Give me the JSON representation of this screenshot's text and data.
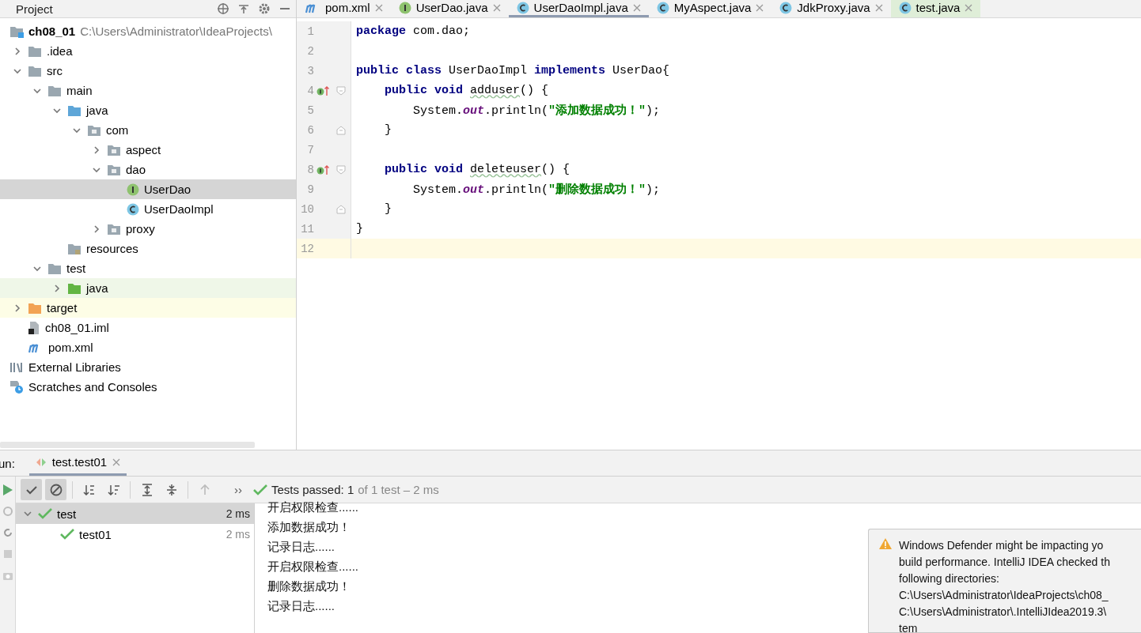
{
  "project_panel": {
    "title": "Project",
    "tree": [
      {
        "label": "ch08_01",
        "kind": "module",
        "path": "C:\\Users\\Administrator\\IdeaProjects\\",
        "expanded": true,
        "selected": false,
        "children": [
          {
            "label": ".idea",
            "kind": "folder",
            "expanded": false,
            "selected": false
          },
          {
            "label": "src",
            "kind": "folder",
            "expanded": true,
            "selected": false,
            "children": [
              {
                "label": "main",
                "kind": "folder",
                "expanded": true,
                "selected": false,
                "children": [
                  {
                    "label": "java",
                    "kind": "source",
                    "expanded": true,
                    "selected": false,
                    "children": [
                      {
                        "label": "com",
                        "kind": "package",
                        "expanded": true,
                        "selected": false,
                        "children": [
                          {
                            "label": "aspect",
                            "kind": "package",
                            "expanded": false,
                            "selected": false
                          },
                          {
                            "label": "dao",
                            "kind": "package",
                            "expanded": true,
                            "selected": false,
                            "children": [
                              {
                                "label": "UserDao",
                                "kind": "interface",
                                "selected": true
                              },
                              {
                                "label": "UserDaoImpl",
                                "kind": "class",
                                "selected": false
                              }
                            ]
                          },
                          {
                            "label": "proxy",
                            "kind": "package",
                            "expanded": false,
                            "selected": false
                          }
                        ]
                      }
                    ]
                  },
                  {
                    "label": "resources",
                    "kind": "resources",
                    "selected": false
                  }
                ]
              },
              {
                "label": "test",
                "kind": "folder",
                "expanded": true,
                "selected": false,
                "children": [
                  {
                    "label": "java",
                    "kind": "test-source",
                    "expanded": false,
                    "selected": false
                  }
                ]
              }
            ]
          },
          {
            "label": "target",
            "kind": "excluded",
            "expanded": false,
            "selected": false
          },
          {
            "label": "ch08_01.iml",
            "kind": "iml",
            "selected": false
          },
          {
            "label": "pom.xml",
            "kind": "maven",
            "selected": false
          }
        ]
      },
      {
        "label": "External Libraries",
        "kind": "libraries",
        "selected": false
      },
      {
        "label": "Scratches and Consoles",
        "kind": "scratches",
        "selected": false
      }
    ]
  },
  "editor": {
    "tabs": [
      {
        "label": "pom.xml",
        "kind": "maven",
        "selected": false,
        "test": false
      },
      {
        "label": "UserDao.java",
        "kind": "interface",
        "selected": false,
        "test": false
      },
      {
        "label": "UserDaoImpl.java",
        "kind": "class",
        "selected": true,
        "test": false
      },
      {
        "label": "MyAspect.java",
        "kind": "class",
        "selected": false,
        "test": false
      },
      {
        "label": "JdkProxy.java",
        "kind": "class",
        "selected": false,
        "test": false
      },
      {
        "label": "test.java",
        "kind": "class",
        "selected": false,
        "test": true
      }
    ],
    "lines": [
      {
        "number": "1",
        "kind": "top",
        "current": false,
        "tokens": [
          {
            "kind": "keyword",
            "text": "package"
          },
          {
            "kind": "plain",
            "text": " com.dao;"
          }
        ]
      },
      {
        "number": "2",
        "current": false
      },
      {
        "number": "3",
        "kind": "top",
        "current": false,
        "tokens": [
          {
            "kind": "keyword",
            "text": "public class"
          },
          {
            "kind": "plain",
            "text": " UserDaoImpl "
          },
          {
            "kind": "keyword",
            "text": "implements"
          },
          {
            "kind": "plain",
            "text": " UserDao{"
          }
        ]
      },
      {
        "number": "4",
        "kind": "member",
        "current": false,
        "implements": true,
        "fold_start": true,
        "tokens": [
          {
            "kind": "keyword",
            "text": "public void "
          },
          {
            "kind": "unused",
            "text": "adduser"
          },
          {
            "kind": "plain",
            "text": "() {"
          }
        ]
      },
      {
        "number": "5",
        "kind": "statement",
        "current": false,
        "tokens": [
          {
            "kind": "plain",
            "text": "System."
          },
          {
            "kind": "static",
            "text": "out"
          },
          {
            "kind": "plain",
            "text": ".println("
          },
          {
            "kind": "string",
            "text": "\"添加数据成功！\""
          },
          {
            "kind": "plain",
            "text": ");"
          }
        ]
      },
      {
        "number": "6",
        "kind": "member",
        "current": false,
        "fold_end": true,
        "tokens": [
          {
            "kind": "plain",
            "text": "}"
          }
        ]
      },
      {
        "number": "7",
        "current": false
      },
      {
        "number": "8",
        "kind": "member",
        "current": false,
        "implements": true,
        "fold_start": true,
        "tokens": [
          {
            "kind": "keyword",
            "text": "public void "
          },
          {
            "kind": "unused",
            "text": "deleteuser"
          },
          {
            "kind": "plain",
            "text": "() {"
          }
        ]
      },
      {
        "number": "9",
        "kind": "statement",
        "current": false,
        "tokens": [
          {
            "kind": "plain",
            "text": "System."
          },
          {
            "kind": "static",
            "text": "out"
          },
          {
            "kind": "plain",
            "text": ".println("
          },
          {
            "kind": "string",
            "text": "\"删除数据成功！\""
          },
          {
            "kind": "plain",
            "text": ");"
          }
        ]
      },
      {
        "number": "10",
        "kind": "member",
        "current": false,
        "fold_end": true,
        "tokens": [
          {
            "kind": "plain",
            "text": "}"
          }
        ]
      },
      {
        "number": "11",
        "kind": "top",
        "current": false,
        "tokens": [
          {
            "kind": "plain",
            "text": "}"
          }
        ]
      },
      {
        "number": "12",
        "current": true
      }
    ]
  },
  "run_panel": {
    "label": "un:",
    "tab": "test.test01",
    "toolbar": [
      {
        "kind": "check",
        "on": true
      },
      {
        "kind": "ignored",
        "on": true
      },
      {
        "kind": "sort-alpha",
        "on": false
      },
      {
        "kind": "sort-duration",
        "on": false
      },
      {
        "kind": "expand",
        "on": false
      },
      {
        "kind": "collapse",
        "on": false
      },
      {
        "kind": "up",
        "disabled": true
      }
    ],
    "more": "››",
    "status": {
      "main": "Tests passed: 1",
      "detail": "of 1 test – 2 ms"
    },
    "tests": [
      {
        "label": "test",
        "time": "2 ms",
        "selected": true,
        "expanded": true,
        "children": [
          {
            "label": "test01",
            "time": "2 ms",
            "selected": false
          }
        ]
      }
    ],
    "console": [
      "开启权限检查......",
      "添加数据成功！",
      "记录日志......",
      "开启权限检查......",
      "删除数据成功！",
      "记录日志......"
    ]
  },
  "notification": {
    "lines": [
      "Windows Defender might be impacting yo",
      "build performance. IntelliJ IDEA checked th",
      "following directories:",
      "C:\\Users\\Administrator\\IdeaProjects\\ch08_",
      "C:\\Users\\Administrator\\.IntelliJIdea2019.3\\",
      "tem"
    ]
  }
}
